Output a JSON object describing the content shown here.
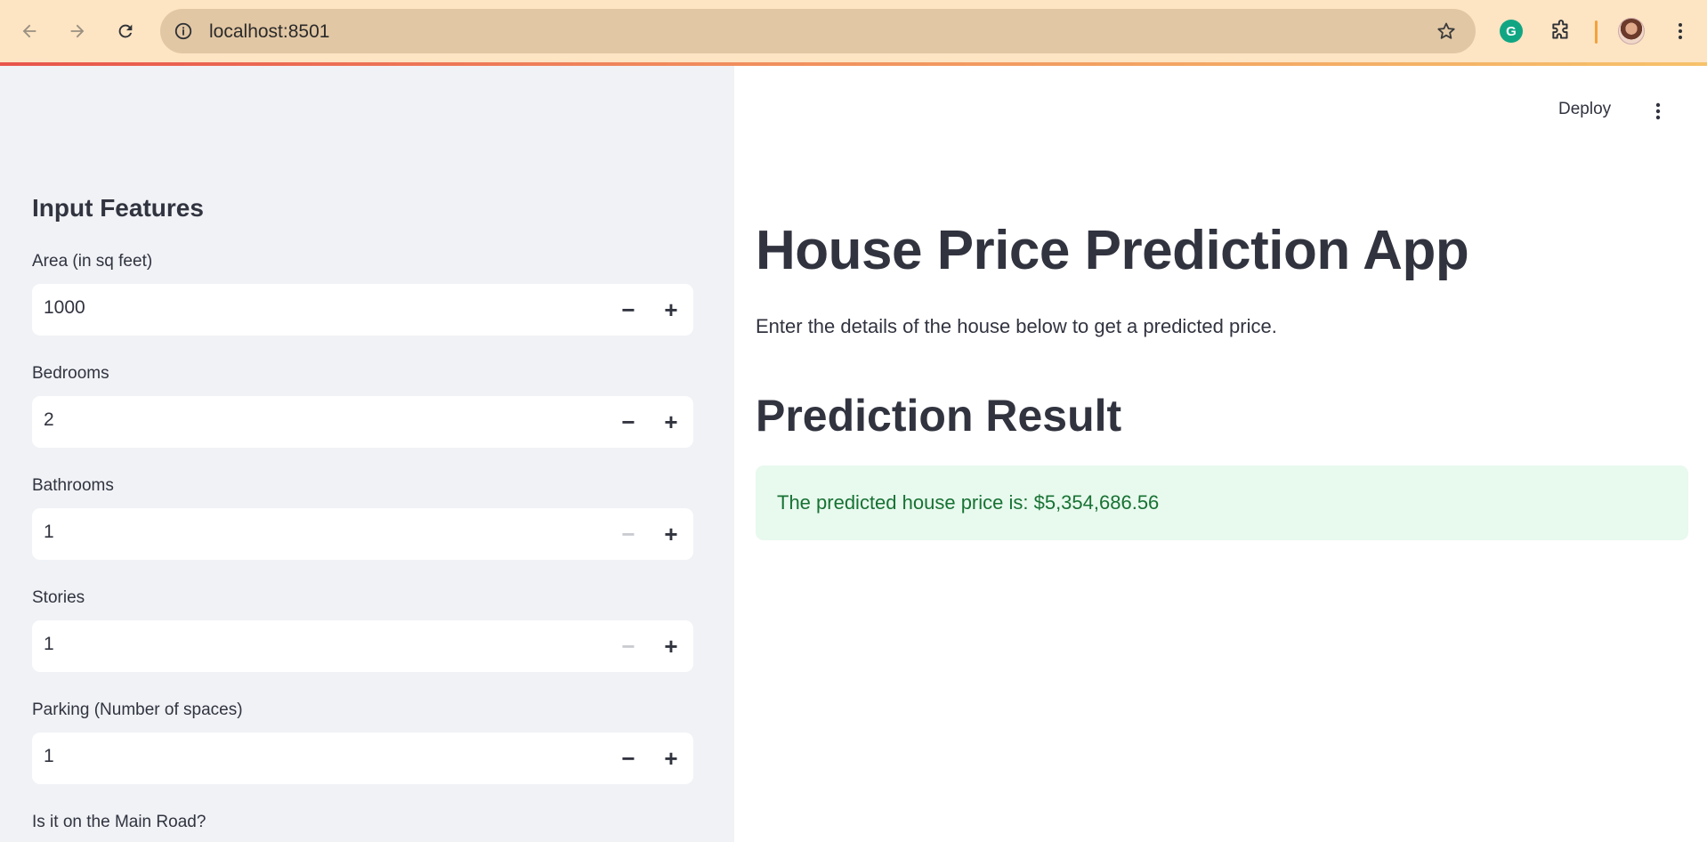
{
  "browser": {
    "url": "localhost:8501"
  },
  "app_header": {
    "deploy_label": "Deploy"
  },
  "sidebar": {
    "title": "Input Features",
    "fields": [
      {
        "label": "Area (in sq feet)",
        "value": "1000",
        "minus_disabled": false
      },
      {
        "label": "Bedrooms",
        "value": "2",
        "minus_disabled": false
      },
      {
        "label": "Bathrooms",
        "value": "1",
        "minus_disabled": true
      },
      {
        "label": "Stories",
        "value": "1",
        "minus_disabled": true
      },
      {
        "label": "Parking (Number of spaces)",
        "value": "1",
        "minus_disabled": false
      }
    ],
    "next_label": "Is it on the Main Road?"
  },
  "main": {
    "title": "House Price Prediction App",
    "description": "Enter the details of the house below to get a predicted price.",
    "result_heading": "Prediction Result",
    "result_text": "The predicted house price is: $5,354,686.56"
  },
  "colors": {
    "sidebar_bg": "#f0f2f6",
    "success_bg": "#e8f9ee",
    "success_text": "#177233",
    "chrome_bg": "#fde4c3"
  }
}
